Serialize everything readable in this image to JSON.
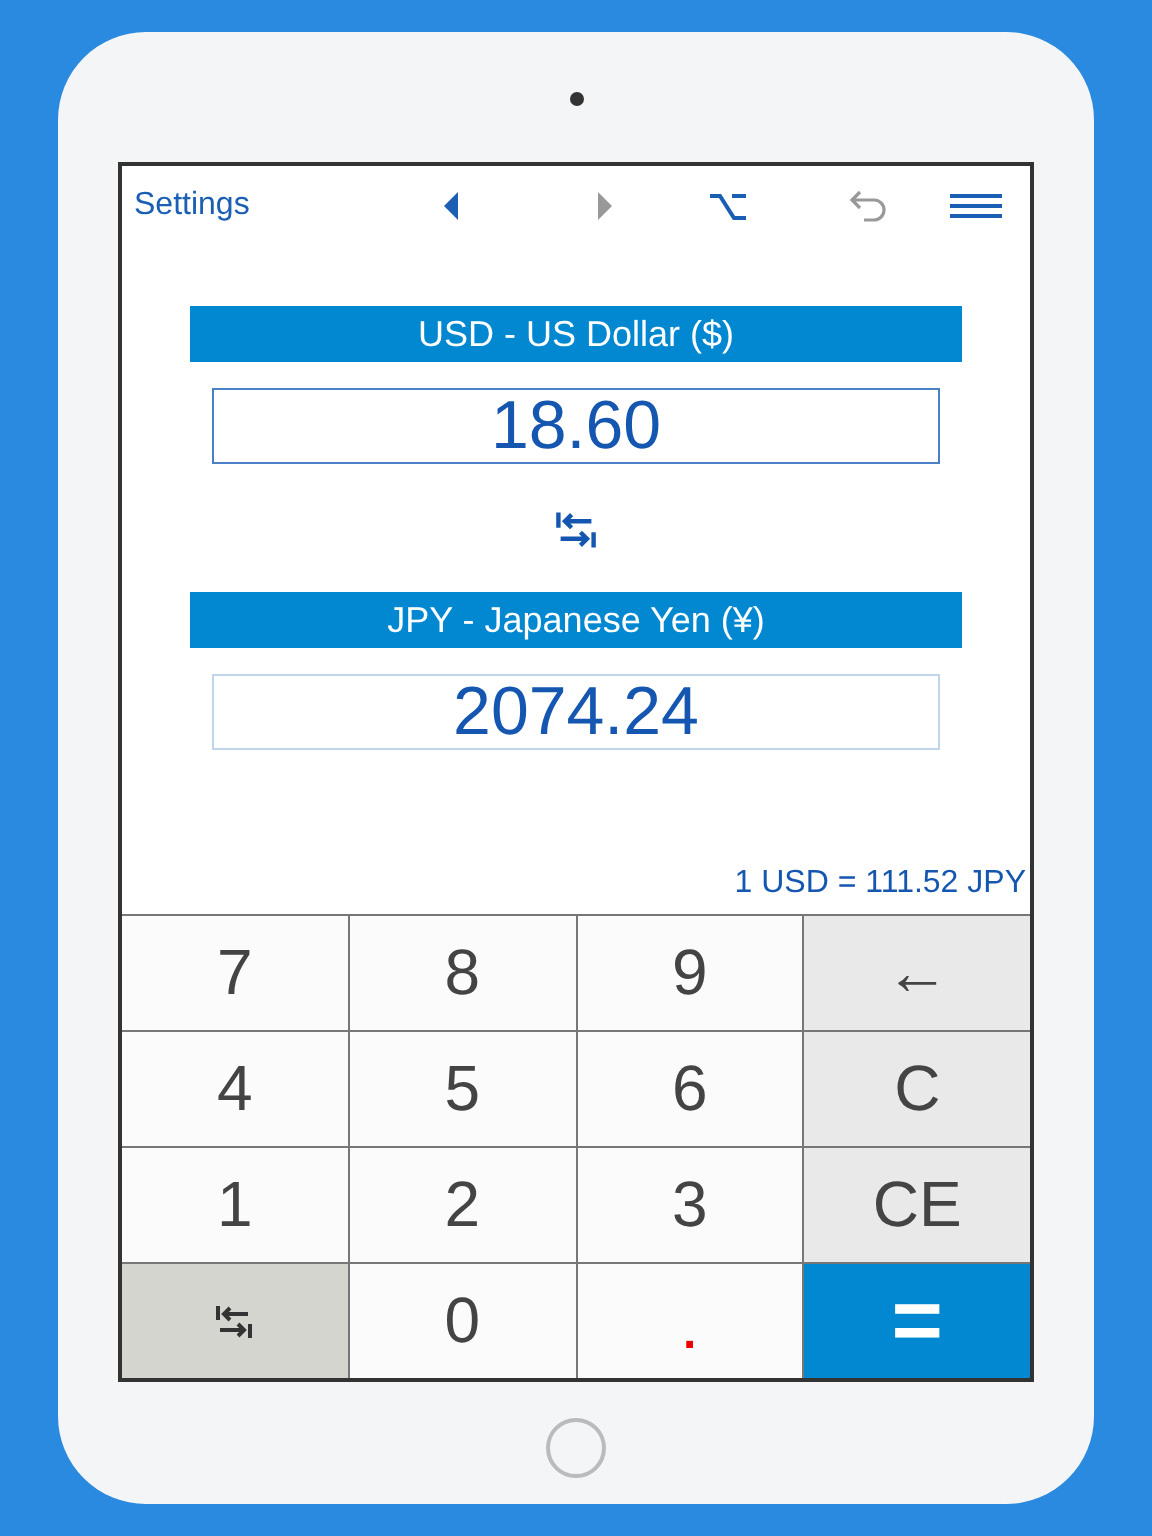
{
  "toolbar": {
    "settings": "Settings",
    "back": {
      "enabled": true
    },
    "forward": {
      "enabled": false
    },
    "undo": {
      "enabled": false
    }
  },
  "from": {
    "currency": "USD - US Dollar ($)",
    "value": "18.60",
    "focused": true
  },
  "to": {
    "currency": "JPY - Japanese Yen (¥)",
    "value": "2074.24",
    "focused": false
  },
  "rate": "1 USD = 111.52 JPY",
  "keys": [
    {
      "kind": "digit",
      "label": "7"
    },
    {
      "kind": "digit",
      "label": "8"
    },
    {
      "kind": "digit",
      "label": "9"
    },
    {
      "kind": "function",
      "label": "←"
    },
    {
      "kind": "digit",
      "label": "4"
    },
    {
      "kind": "digit",
      "label": "5"
    },
    {
      "kind": "digit",
      "label": "6"
    },
    {
      "kind": "function",
      "label": "C"
    },
    {
      "kind": "digit",
      "label": "1"
    },
    {
      "kind": "digit",
      "label": "2"
    },
    {
      "kind": "digit",
      "label": "3"
    },
    {
      "kind": "function",
      "label": "CE"
    },
    {
      "kind": "swap"
    },
    {
      "kind": "digit",
      "label": "0"
    },
    {
      "kind": "dot",
      "label": "."
    },
    {
      "kind": "equals",
      "label": "="
    }
  ]
}
